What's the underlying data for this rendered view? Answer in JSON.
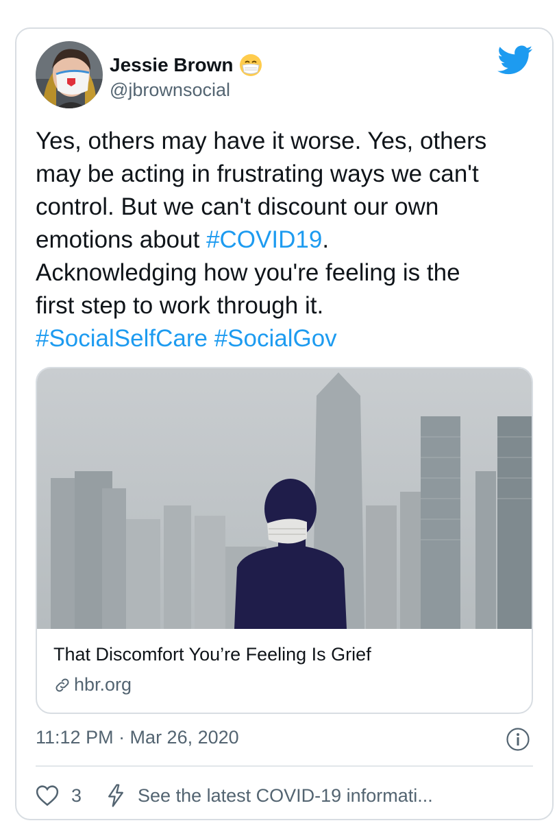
{
  "author": {
    "name": "Jessie Brown",
    "handle": "@jbrownsocial",
    "name_emoji": "face-with-medical-mask-emoji"
  },
  "tweet": {
    "line1": "Yes, others may have it worse. Yes, others",
    "line2": "may be acting in frustrating ways we can't",
    "line3": "control. But we can't discount our own",
    "line4_prefix": "emotions about ",
    "hashtag_covid": "#COVID19",
    "line4_suffix": ".",
    "line5": "Acknowledging how you're feeling is the",
    "line6": "first step to work through it.",
    "hashtag_selfcare": "#SocialSelfCare",
    "hashtag_gov": "#SocialGov"
  },
  "link_card": {
    "title": "That Discomfort You’re Feeling Is Grief",
    "domain": "hbr.org"
  },
  "meta": {
    "timestamp": "11:12 PM · Mar 26, 2020"
  },
  "actions": {
    "like_count": "3",
    "covid_info": "See the latest COVID-19 informati..."
  },
  "colors": {
    "link_blue": "#1d9bf0",
    "text": "#0f1419",
    "secondary": "#536471",
    "border": "#d8dde2"
  },
  "icons": [
    "avatar",
    "face-with-medical-mask-emoji",
    "twitter-bird-icon",
    "link-icon",
    "info-icon",
    "heart-icon",
    "lightning-icon"
  ]
}
